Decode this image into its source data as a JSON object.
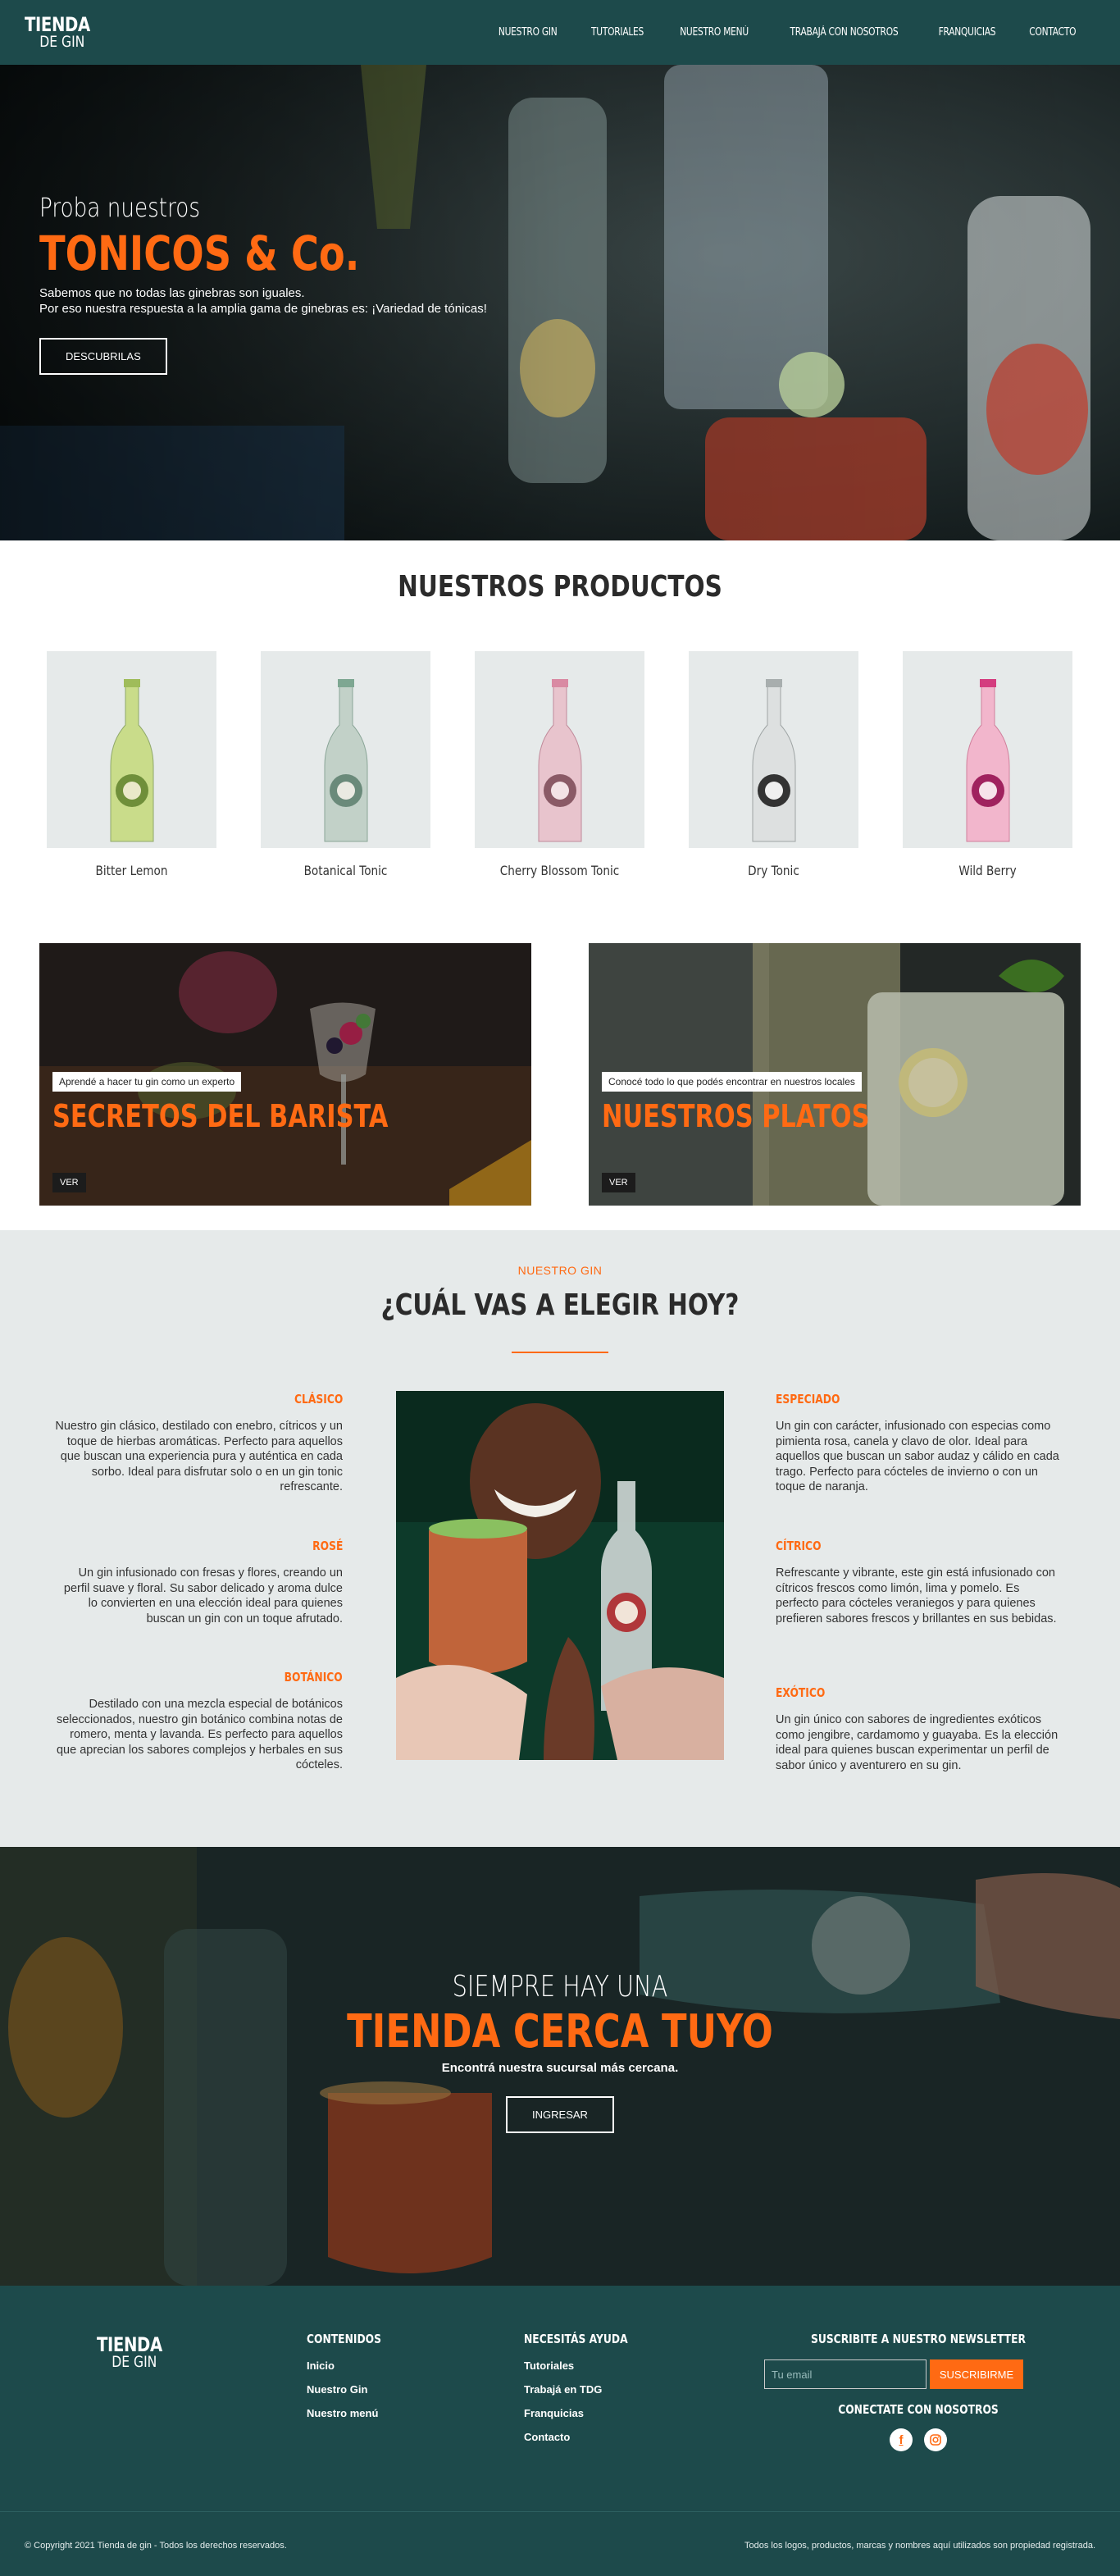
{
  "brand": {
    "line1": "TIENDA",
    "line2": "DE GIN"
  },
  "nav": {
    "items": [
      "NUESTRO GIN",
      "TUTORIALES",
      "NUESTRO MENÚ",
      "TRABAJÁ CON NOSOTROS",
      "FRANQUICIAS",
      "CONTACTO"
    ]
  },
  "hero": {
    "pre": "Proba nuestros",
    "title": "TONICOS & Co.",
    "desc1": "Sabemos que no todas las ginebras son iguales.",
    "desc2": "Por eso nuestra respuesta a la amplia gama de ginebras es: ¡Variedad de tónicas!",
    "button": "DESCUBRILAS"
  },
  "products": {
    "title": "NUESTROS PRODUCTOS",
    "items": [
      {
        "name": "Bitter Lemon",
        "color": "#b5d36a"
      },
      {
        "name": "Botanical Tonic",
        "color": "#b6c9bf"
      },
      {
        "name": "Cherry Blossom Tonic",
        "color": "#e2b8c4"
      },
      {
        "name": "Dry Tonic",
        "color": "#d6d9d9"
      },
      {
        "name": "Wild Berry",
        "color": "#f0a9c4"
      }
    ]
  },
  "promos": [
    {
      "tag": "Aprendé a hacer tu gin como un experto",
      "title": "SECRETOS DEL BARISTA",
      "button": "VER"
    },
    {
      "tag": "Conocé todo lo que podés encontrar en nuestros locales",
      "title": "NUESTROS PLATOS",
      "button": "VER"
    }
  ],
  "gin": {
    "kicker": "NUESTRO GIN",
    "title": "¿CUÁL VAS A ELEGIR HOY?",
    "left": [
      {
        "title": "CLÁSICO",
        "text": "Nuestro gin clásico, destilado con enebro, cítricos y un toque de hierbas aromáticas. Perfecto para aquellos que buscan una experiencia pura y auténtica en cada sorbo. Ideal para disfrutar solo o en un gin tonic refrescante."
      },
      {
        "title": "ROSÉ",
        "text": "Un gin infusionado con fresas y flores, creando un perfil suave y floral. Su sabor delicado y aroma dulce lo convierten en una elección ideal para quienes buscan un gin con un toque afrutado."
      },
      {
        "title": "BOTÁNICO",
        "text": "Destilado con una mezcla especial de botánicos seleccionados, nuestro gin botánico combina notas de romero, menta y lavanda. Es perfecto para aquellos que aprecian los sabores complejos y herbales en sus cócteles."
      }
    ],
    "right": [
      {
        "title": "ESPECIADO",
        "text": "Un gin con carácter, infusionado con especias como pimienta rosa, canela y clavo de olor. Ideal para aquellos que buscan un sabor audaz y cálido en cada trago. Perfecto para cócteles de invierno o con un toque de naranja."
      },
      {
        "title": "CÍTRICO",
        "text": "Refrescante y vibrante, este gin está infusionado con cítricos frescos como limón, lima y pomelo. Es perfecto para cócteles veraniegos y para quienes prefieren sabores frescos y brillantes en sus bebidas."
      },
      {
        "title": "EXÓTICO",
        "text": "Un gin único con sabores de ingredientes exóticos como jengibre, cardamomo y guayaba. Es la elección ideal para quienes buscan experimentar un perfil de sabor único y aventurero en su gin."
      }
    ]
  },
  "store": {
    "pre": "SIEMPRE HAY UNA",
    "title": "TIENDA CERCA TUYO",
    "desc": "Encontrá nuestra sucursal más cercana.",
    "button": "INGRESAR"
  },
  "footer": {
    "contents": {
      "title": "CONTENIDOS",
      "links": [
        "Inicio",
        "Nuestro Gin",
        "Nuestro menú"
      ]
    },
    "help": {
      "title": "NECESITÁS AYUDA",
      "links": [
        "Tutoriales",
        "Trabajá en TDG",
        "Franquicias",
        "Contacto"
      ]
    },
    "newsletter": {
      "title": "SUSCRIBITE A NUESTRO NEWSLETTER",
      "placeholder": "Tu email",
      "button": "SUSCRIBIRME"
    },
    "social": {
      "title": "CONECTATE CON NOSOTROS",
      "icons": [
        "facebook-icon",
        "instagram-icon"
      ]
    },
    "copyright": "© Copyright 2021 Tienda de gin - Todos los derechos reservados.",
    "legal": "Todos los logos, productos, marcas y nombres aquí utilizados son propiedad registrada."
  },
  "colors": {
    "brand": "#1d4a4b",
    "accent": "#ff6a13",
    "panel": "#e6eaea"
  }
}
